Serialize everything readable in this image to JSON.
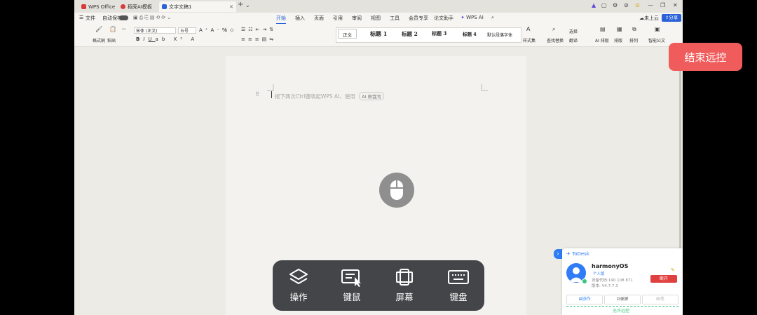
{
  "tabs": [
    {
      "label": "WPS Office",
      "color": "#d93b3b"
    },
    {
      "label": "稻壳AI模板",
      "color": "#d93b3b"
    },
    {
      "label": "文字文稿1",
      "color": "#2b62d9"
    }
  ],
  "menu": {
    "file": "文件",
    "autosave": "自动保存",
    "items": [
      "开始",
      "插入",
      "页面",
      "引用",
      "审阅",
      "视图",
      "工具",
      "会员专享",
      "论文助手",
      "WPS AI"
    ],
    "active": "开始",
    "cloud": "未上云",
    "share": "分享"
  },
  "ribbon": {
    "format_painter": "格式刷",
    "paste": "粘贴",
    "font_name": "宋体 (正文)",
    "font_size": "五号",
    "styles": [
      "正文",
      "标题 1",
      "标题 2",
      "标题 3",
      "标题 4",
      "默认段落字体"
    ],
    "style_set": "样式集",
    "find_replace": "查找替换",
    "select": "选择",
    "translate": "翻译",
    "ai_layout": "AI 排版",
    "layout": "排版",
    "arrange": "排列",
    "smart_doc": "智能公文"
  },
  "document": {
    "hint": "按下两次Ctrl键唤起WPS AI，使用",
    "ai_write": "AI 帮我写"
  },
  "remote": {
    "end_button": "结束远控",
    "tools": [
      {
        "label": "操作",
        "icon": "layers-icon"
      },
      {
        "label": "键鼠",
        "icon": "keyboard-mouse-icon"
      },
      {
        "label": "屏幕",
        "icon": "phone-screen-icon"
      },
      {
        "label": "键盘",
        "icon": "keyboard-icon"
      }
    ]
  },
  "todesk": {
    "brand": "ToDesk",
    "device_name": "harmonyOS",
    "tag": "个人版",
    "device_code": "设备代码:190 108 871",
    "version": "版本: V4.7.7.3",
    "disconnect": "断开",
    "collaborate": "协作",
    "record": "录屏",
    "notes": "画笔",
    "status": "允许远控"
  },
  "colors": {
    "accent": "#2b62d9",
    "end_button": "#f05b5b",
    "todesk_blue": "#2f7cf6"
  }
}
